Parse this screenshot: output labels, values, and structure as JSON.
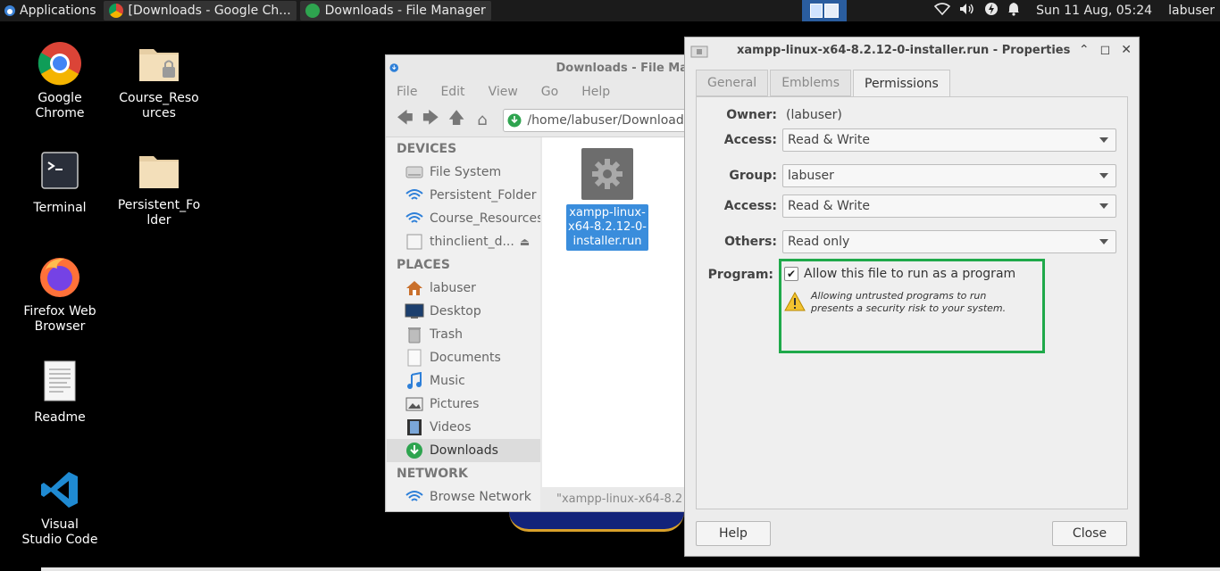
{
  "panel": {
    "applications_label": "Applications",
    "tasks": [
      {
        "label": "[Downloads - Google Ch..."
      },
      {
        "label": "Downloads - File Manager"
      }
    ],
    "clock": "Sun 11 Aug, 05:24",
    "user": "labuser",
    "colors": {
      "panel_bg": "#1b1b1b",
      "workspace": "#2a5d9f"
    }
  },
  "desktop": {
    "icons": [
      {
        "label": "Google Chrome",
        "icon": "chrome-icon"
      },
      {
        "label": "Course_Resources",
        "icon": "folder-locked-icon"
      },
      {
        "label": "Terminal",
        "icon": "terminal-icon"
      },
      {
        "label": "Persistent_Folder",
        "icon": "folder-icon"
      },
      {
        "label": "Firefox Web Browser",
        "icon": "firefox-icon"
      },
      {
        "label": "Readme",
        "icon": "document-icon"
      },
      {
        "label": "Visual Studio Code",
        "icon": "vscode-icon"
      }
    ]
  },
  "file_manager": {
    "title": "Downloads - File Ma",
    "menu": [
      "File",
      "Edit",
      "View",
      "Go",
      "Help"
    ],
    "location": "/home/labuser/Downloads/",
    "sidebar": {
      "devices_header": "DEVICES",
      "devices": [
        "File System",
        "Persistent_Folder",
        "Course_Resources",
        "thinclient_d..."
      ],
      "places_header": "PLACES",
      "places": [
        "labuser",
        "Desktop",
        "Trash",
        "Documents",
        "Music",
        "Pictures",
        "Videos",
        "Downloads"
      ],
      "network_header": "NETWORK",
      "network": [
        "Browse Network"
      ],
      "selected": "Downloads"
    },
    "file": {
      "name": "xampp-linux-x64-8.2.12-0-installer.run"
    },
    "status": "\"xampp-linux-x64-8.2"
  },
  "properties": {
    "title": "xampp-linux-x64-8.2.12-0-installer.run - Properties",
    "tabs": [
      "General",
      "Emblems",
      "Permissions"
    ],
    "active_tab": "Permissions",
    "owner_label": "Owner:",
    "owner_value": "(labuser)",
    "owner_access_label": "Access:",
    "owner_access": "Read & Write",
    "group_label": "Group:",
    "group_value": "labuser",
    "group_access_label": "Access:",
    "group_access": "Read & Write",
    "others_label": "Others:",
    "others_access": "Read only",
    "program_label": "Program:",
    "program_checkbox_label": "Allow this file to run as a program",
    "program_checked": true,
    "warning_line1": "Allowing untrusted programs to run",
    "warning_line2": "presents a security risk to your system.",
    "help_button": "Help",
    "close_button": "Close",
    "highlight_color": "#1fa94a"
  }
}
